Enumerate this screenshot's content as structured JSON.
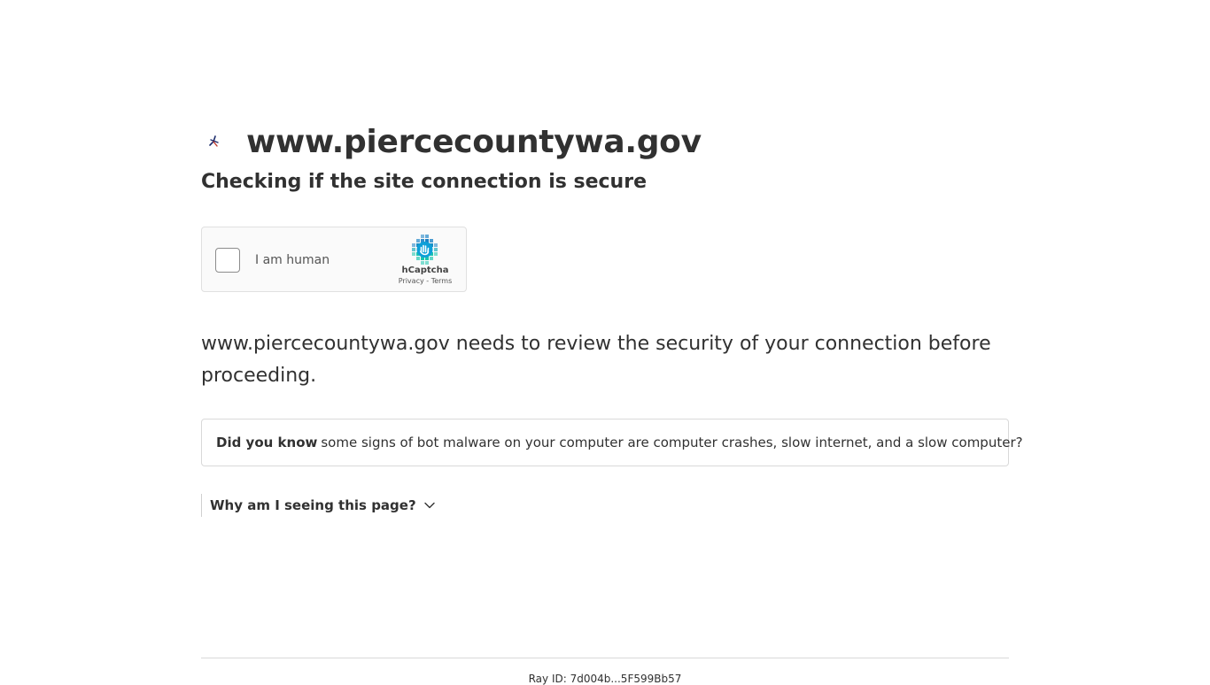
{
  "header": {
    "site_name": "www.piercecountywa.gov",
    "favicon_icon": "pierce-county-logo-icon"
  },
  "subtitle": "Checking if the site connection is secure",
  "captcha": {
    "label": "I am human",
    "brand": "hCaptcha",
    "privacy_link": "Privacy",
    "separator": " - ",
    "terms_link": "Terms",
    "checked": false,
    "brand_color": "#0074bf",
    "accent_color": "#00bfa5"
  },
  "review_message": "www.piercecountywa.gov needs to review the security of your connection before proceeding.",
  "did_you_know": {
    "lead": "Did you know",
    "text": "some signs of bot malware on your computer are computer crashes, slow internet, and a slow computer?"
  },
  "why_section": {
    "label": "Why am I seeing this page?",
    "icon": "chevron-down-icon",
    "expanded": false
  },
  "footer": {
    "ray_id_text": "Ray ID: 7d004b...5F599Bb57"
  }
}
